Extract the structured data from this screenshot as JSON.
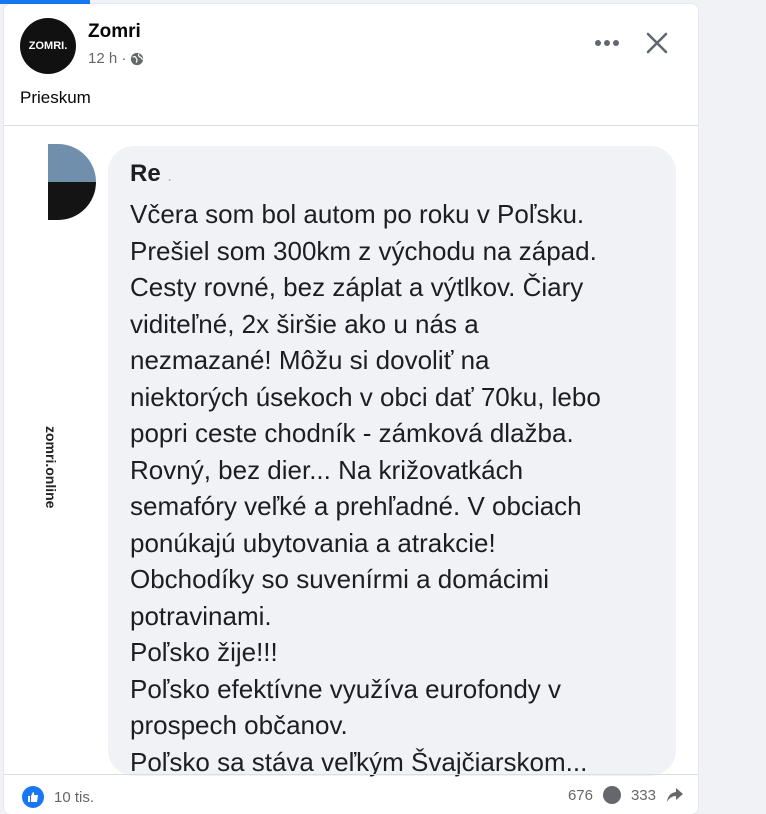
{
  "post": {
    "author": "Zomri",
    "avatar_text": "ZOMRI.",
    "time": "12 h ·",
    "caption": "Prieskum"
  },
  "screenshot": {
    "watermark": "zomri.online",
    "commenter": "Re",
    "commenter_suffix": ".",
    "comment_lines": [
      "Včera som bol autom po roku v Poľsku.",
      "Prešiel som 300km z východu na západ.",
      "Cesty rovné, bez záplat a výtlkov. Čiary",
      "viditeľné, 2x širšie ako u nás a",
      "nezmazané! Môžu si dovoliť na",
      "niektorých úsekoch v obci dať 70ku, lebo",
      "popri ceste chodník - zámková dlažba.",
      "Rovný, bez dier... Na križovatkách",
      "semafóry veľké a prehľadné. V obciach",
      "ponúkajú ubytovania a atrakcie!",
      "Obchodíky so suvenírmi a domácimi",
      "potravinami.",
      "Poľsko žije!!!",
      "Poľsko efektívne využíva eurofondy v",
      "prospech občanov.",
      "Poľsko sa stáva veľkým Švajčiarskom..."
    ]
  },
  "footer": {
    "reaction_count": "10 tis.",
    "comment_count": "676",
    "share_count": "333"
  },
  "icons": {
    "more": "more-options-icon",
    "close": "close-icon",
    "globe": "globe-icon",
    "like": "like-icon"
  },
  "colors": {
    "accent": "#1877f2",
    "bubble": "#f0f2f5",
    "meta_text": "#65676b"
  }
}
